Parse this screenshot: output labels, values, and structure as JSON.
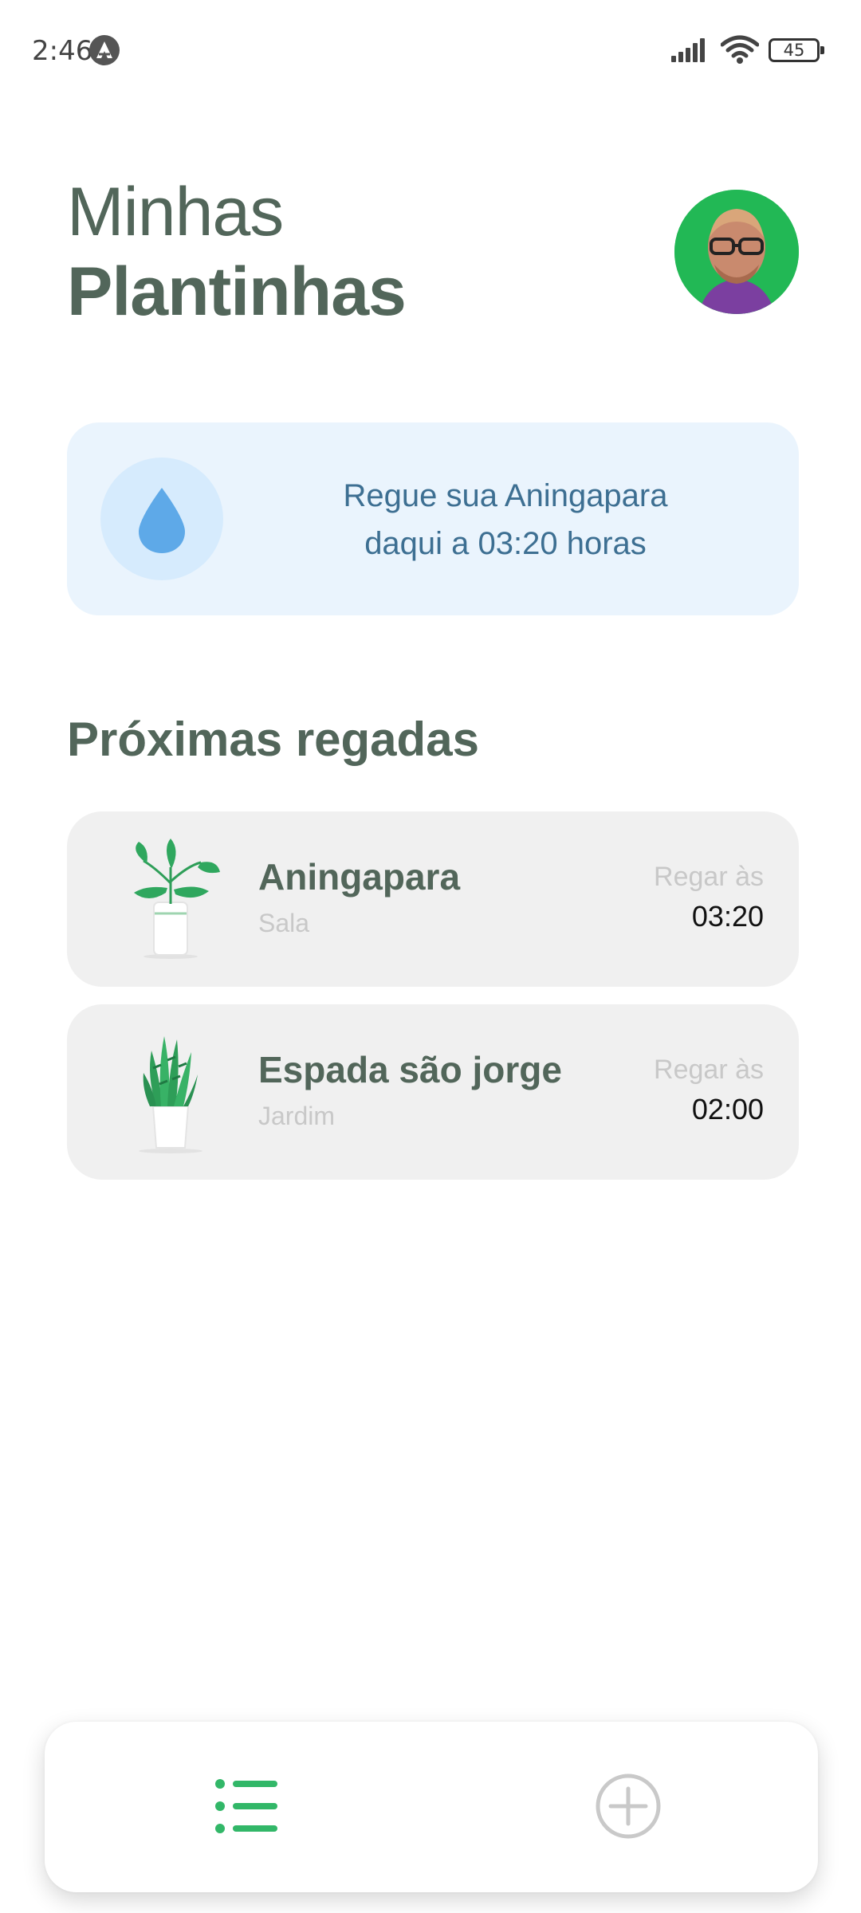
{
  "status_bar": {
    "time": "2:46",
    "battery": "45",
    "icons": [
      "app-notification-icon",
      "signal-icon",
      "wifi-icon",
      "battery-icon"
    ]
  },
  "header": {
    "greeting_line1": "Minhas",
    "greeting_line2": "Plantinhas",
    "avatar": "user-avatar"
  },
  "tip": {
    "line1": "Regue sua Aningapara",
    "line2": "daqui a 03:20 horas",
    "icon": "water-drop-icon"
  },
  "section_title": "Próximas regadas",
  "plants": [
    {
      "name": "Aningapara",
      "room": "Sala",
      "water_label": "Regar às",
      "water_time": "03:20",
      "image": "potted-leafy-plant"
    },
    {
      "name": "Espada são jorge",
      "room": "Jardim",
      "water_label": "Regar às",
      "water_time": "02:00",
      "image": "potted-snake-plant"
    }
  ],
  "tab_bar": {
    "tabs": [
      {
        "name": "list",
        "icon": "list-icon",
        "active": true
      },
      {
        "name": "add",
        "icon": "add-circle-icon",
        "active": false
      }
    ]
  },
  "colors": {
    "heading": "#52665a",
    "accent_green": "#32b768",
    "tip_background": "#eaf4fd",
    "tip_text": "#3d6f92",
    "drop_blue": "#5ea9e8",
    "card_background": "#f0f0f0"
  }
}
